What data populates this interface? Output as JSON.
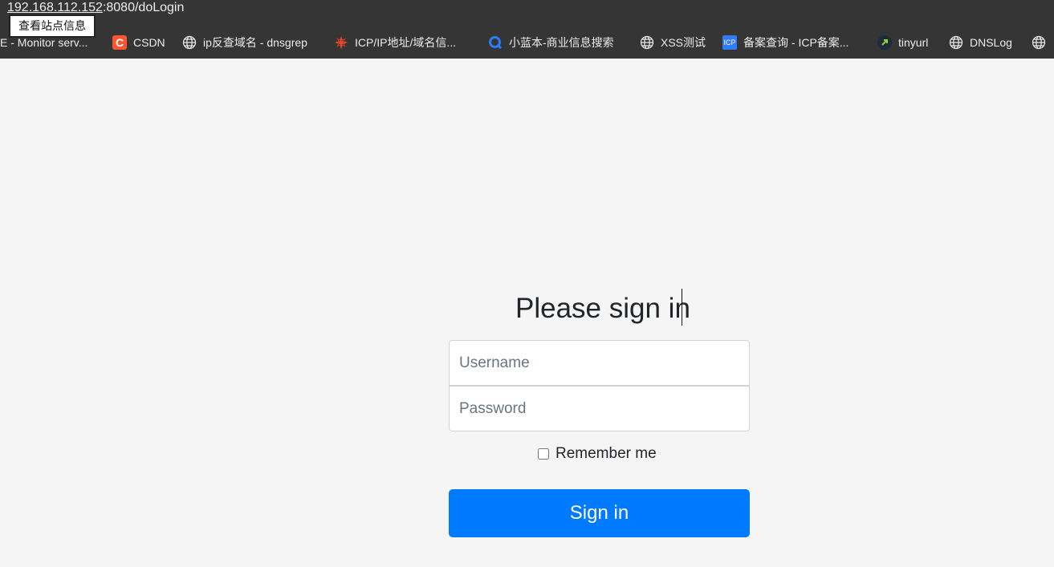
{
  "browser": {
    "url_host": "192.168.112.152",
    "url_rest": ":8080/doLogin",
    "tooltip": "查看站点信息",
    "bookmarks": [
      {
        "label": "E - Monitor serv...",
        "icon": "page-icon"
      },
      {
        "label": "CSDN",
        "icon": "csdn-logo-icon",
        "icon_text": "C",
        "color": "#fc5531"
      },
      {
        "label": "ip反查域名 - dnsgrep",
        "icon": "globe-icon"
      },
      {
        "label": "ICP/IP地址/域名信...",
        "icon": "spinner-logo-icon"
      },
      {
        "label": "小蓝本-商业信息搜索",
        "icon": "q-logo-icon"
      },
      {
        "label": "XSS测试",
        "icon": "globe-icon"
      },
      {
        "label": "备案查询 - ICP备案...",
        "icon": "icp-logo-icon",
        "icon_text": "ICP"
      },
      {
        "label": "tinyurl",
        "icon": "tinyurl-logo-icon"
      },
      {
        "label": "DNSLog",
        "icon": "globe-icon"
      },
      {
        "label": "",
        "icon": "globe-icon"
      }
    ]
  },
  "login": {
    "heading": "Please sign in",
    "username_placeholder": "Username",
    "password_placeholder": "Password",
    "remember_label": "Remember me",
    "remember_checked": false,
    "submit_label": "Sign in",
    "accent_color": "#007bff"
  }
}
